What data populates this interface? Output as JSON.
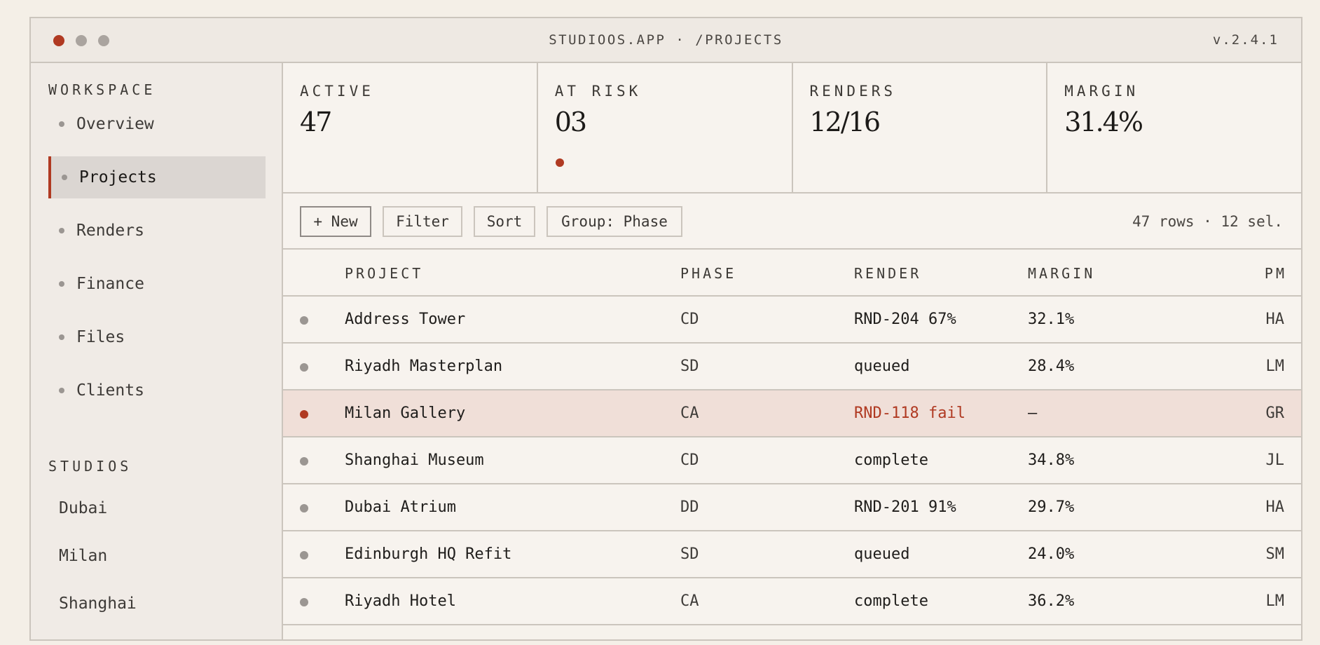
{
  "window": {
    "title": "STUDIOOS.APP · /PROJECTS",
    "version": "v.2.4.1"
  },
  "colors": {
    "accent": "#b03a22",
    "border": "#cbc5bd",
    "background": "#f6f2ec"
  },
  "sidebar": {
    "workspace_label": "WORKSPACE",
    "items": [
      {
        "label": "Overview"
      },
      {
        "label": "Projects",
        "active": true
      },
      {
        "label": "Renders"
      },
      {
        "label": "Finance"
      },
      {
        "label": "Files"
      },
      {
        "label": "Clients"
      }
    ],
    "studios_label": "STUDIOS",
    "studios": [
      "Dubai",
      "Milan",
      "Shanghai"
    ]
  },
  "stats": [
    {
      "label": "ACTIVE",
      "value": "47"
    },
    {
      "label": "AT RISK",
      "value": "03"
    },
    {
      "label": "RENDERS",
      "value": "12/16"
    },
    {
      "label": "MARGIN",
      "value": "31.4%"
    }
  ],
  "toolbar": {
    "new_label": "+ New",
    "filter_label": "Filter",
    "sort_label": "Sort",
    "group_label": "Group: Phase",
    "row_count": "47 rows · 12 sel."
  },
  "table": {
    "columns": [
      "PROJECT",
      "PHASE",
      "RENDER",
      "MARGIN",
      "PM"
    ],
    "rows": [
      {
        "project": "Address Tower",
        "phase": "CD",
        "render": "RND-204 67%",
        "margin": "32.1%",
        "pm": "HA"
      },
      {
        "project": "Riyadh Masterplan",
        "phase": "SD",
        "render": "queued",
        "margin": "28.4%",
        "pm": "LM"
      },
      {
        "project": "Milan Gallery",
        "phase": "CA",
        "render": "RND-118 fail",
        "margin": "—",
        "pm": "GR",
        "alert": true
      },
      {
        "project": "Shanghai Museum",
        "phase": "CD",
        "render": "complete",
        "margin": "34.8%",
        "pm": "JL"
      },
      {
        "project": "Dubai Atrium",
        "phase": "DD",
        "render": "RND-201 91%",
        "margin": "29.7%",
        "pm": "HA"
      },
      {
        "project": "Edinburgh HQ Refit",
        "phase": "SD",
        "render": "queued",
        "margin": "24.0%",
        "pm": "SM"
      },
      {
        "project": "Riyadh Hotel",
        "phase": "CA",
        "render": "complete",
        "margin": "36.2%",
        "pm": "LM"
      }
    ]
  }
}
